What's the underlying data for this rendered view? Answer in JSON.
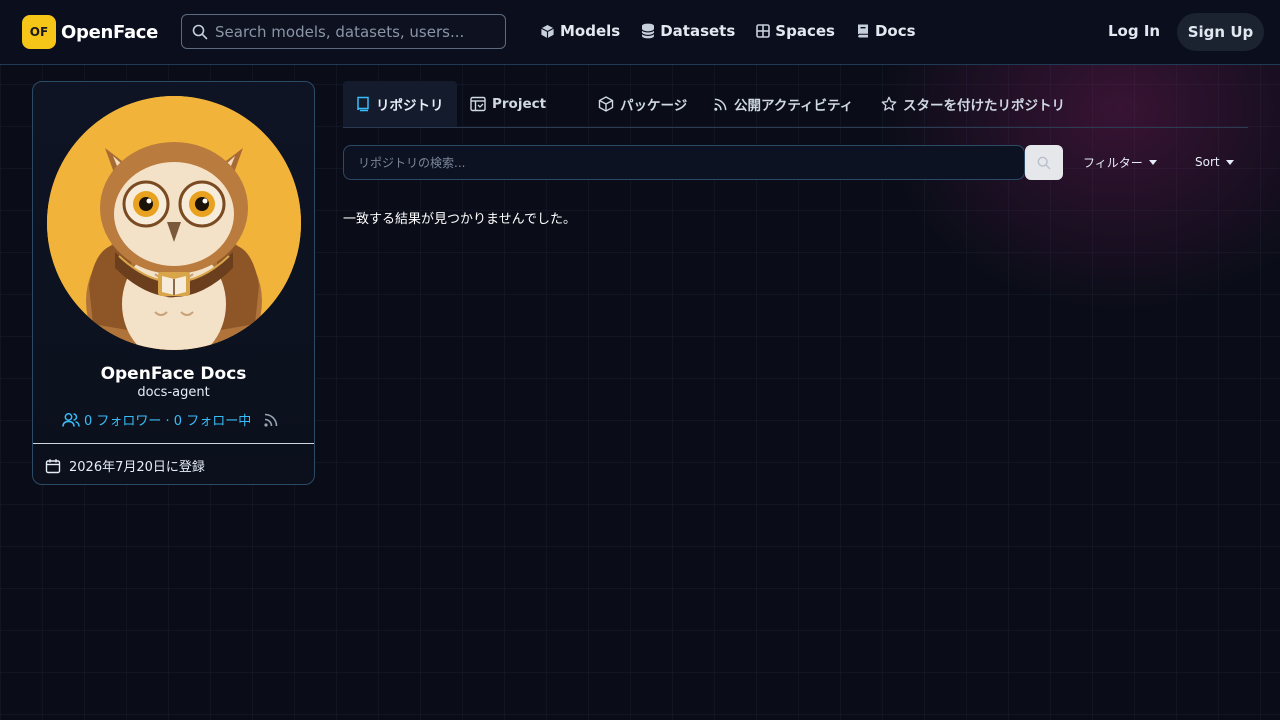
{
  "header": {
    "logo_badge": "OF",
    "logo_text": "OpenFace",
    "search_placeholder": "Search models, datasets, users...",
    "nav": [
      {
        "label": "Models",
        "icon": "cube-icon"
      },
      {
        "label": "Datasets",
        "icon": "database-icon"
      },
      {
        "label": "Spaces",
        "icon": "grid-icon"
      },
      {
        "label": "Docs",
        "icon": "book-icon"
      }
    ],
    "login": "Log In",
    "signup": "Sign Up"
  },
  "profile": {
    "display_name": "OpenFace Docs",
    "username": "docs-agent",
    "follow_text": "0 フォロワー · 0 フォロー中",
    "joined": "2026年7月20日に登録",
    "avatar": "owl-avatar"
  },
  "tabs": [
    {
      "label": "リポジトリ",
      "icon": "repo-icon",
      "active": true
    },
    {
      "label": "Project",
      "icon": "project-icon",
      "active": false
    },
    {
      "label": "パッケージ",
      "icon": "package-icon",
      "active": false
    },
    {
      "label": "公開アクティビティ",
      "icon": "rss-icon",
      "active": false
    },
    {
      "label": "スターを付けたリポジトリ",
      "icon": "star-icon",
      "active": false
    }
  ],
  "repo_search": {
    "placeholder": "リポジトリの検索...",
    "filter_label": "フィルター",
    "sort_label": "Sort"
  },
  "empty_message": "一致する結果が見つかりませんでした。",
  "colors": {
    "accent": "#38bdf8",
    "logo_yellow": "#f5c518",
    "background": "#0a0d18"
  }
}
